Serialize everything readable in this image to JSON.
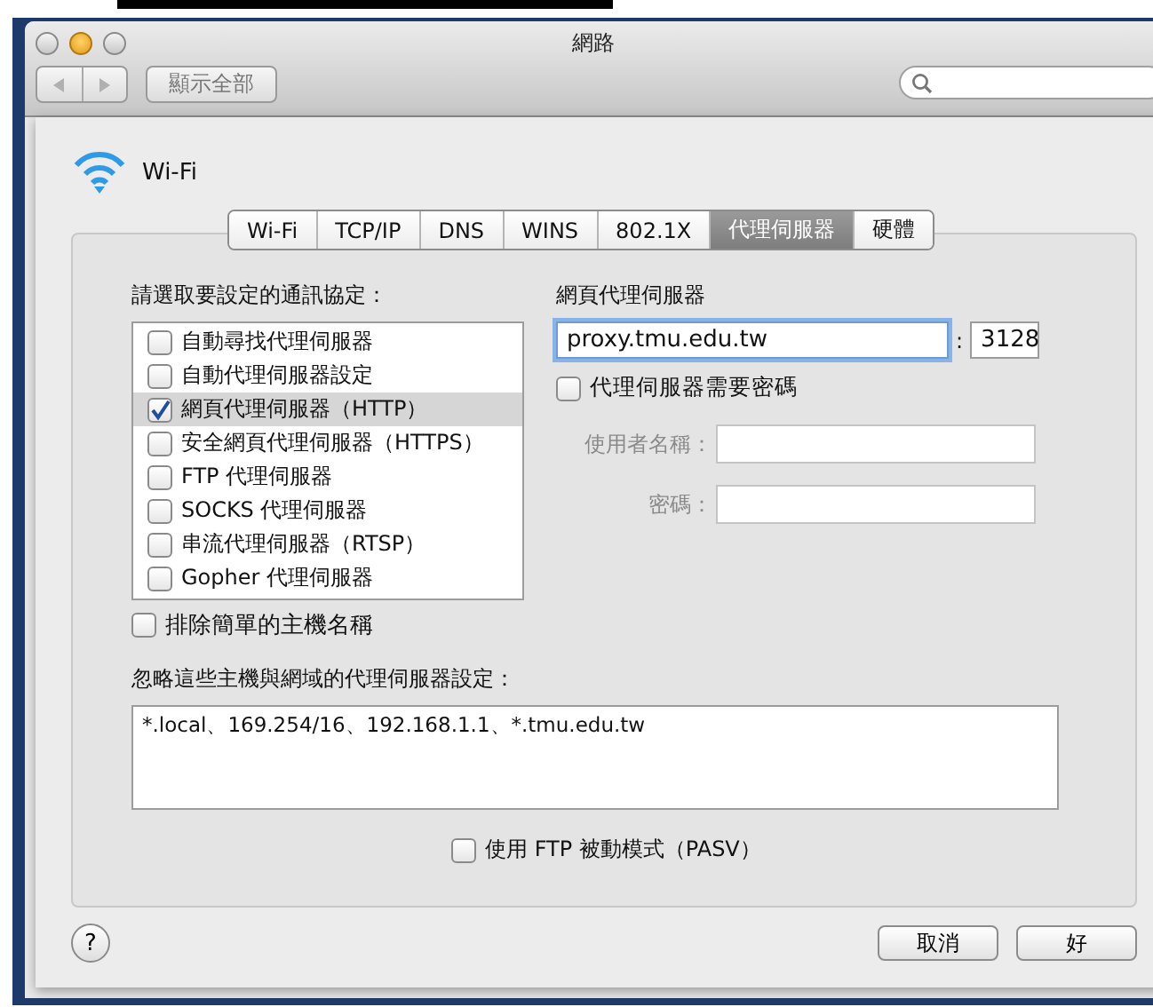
{
  "window": {
    "title": "網路",
    "show_all_button": "顯示全部"
  },
  "service": {
    "name": "Wi-Fi"
  },
  "tabs": [
    {
      "label": "Wi-Fi",
      "selected": false
    },
    {
      "label": "TCP/IP",
      "selected": false
    },
    {
      "label": "DNS",
      "selected": false
    },
    {
      "label": "WINS",
      "selected": false
    },
    {
      "label": "802.1X",
      "selected": false
    },
    {
      "label": "代理伺服器",
      "selected": true
    },
    {
      "label": "硬體",
      "selected": false
    }
  ],
  "protocols": {
    "label": "請選取要設定的通訊協定：",
    "items": [
      {
        "label": "自動尋找代理伺服器",
        "checked": false,
        "selected": false
      },
      {
        "label": "自動代理伺服器設定",
        "checked": false,
        "selected": false
      },
      {
        "label": "網頁代理伺服器（HTTP）",
        "checked": true,
        "selected": true
      },
      {
        "label": "安全網頁代理伺服器（HTTPS）",
        "checked": false,
        "selected": false
      },
      {
        "label": "FTP 代理伺服器",
        "checked": false,
        "selected": false
      },
      {
        "label": "SOCKS 代理伺服器",
        "checked": false,
        "selected": false
      },
      {
        "label": "串流代理伺服器（RTSP）",
        "checked": false,
        "selected": false
      },
      {
        "label": "Gopher 代理伺服器",
        "checked": false,
        "selected": false
      }
    ]
  },
  "web_proxy": {
    "label": "網頁代理伺服器",
    "server": "proxy.tmu.edu.tw",
    "port_separator": ":",
    "port": "3128",
    "requires_password": {
      "label": "代理伺服器需要密碼",
      "checked": false
    },
    "credentials": [
      {
        "label": "使用者名稱：",
        "disabled": true
      },
      {
        "label": "密碼：",
        "disabled": true
      }
    ]
  },
  "exclude_simple_hostnames": {
    "label": "排除簡單的主機名稱",
    "checked": false
  },
  "bypass": {
    "label": "忽略這些主機與網域的代理伺服器設定：",
    "value": "*.local、169.254/16、192.168.1.1、*.tmu.edu.tw"
  },
  "passive_ftp": {
    "label": "使用 FTP 被動模式（PASV）",
    "checked": false
  },
  "help_button": "?",
  "buttons": [
    {
      "label": "取消"
    },
    {
      "label": "好"
    }
  ]
}
